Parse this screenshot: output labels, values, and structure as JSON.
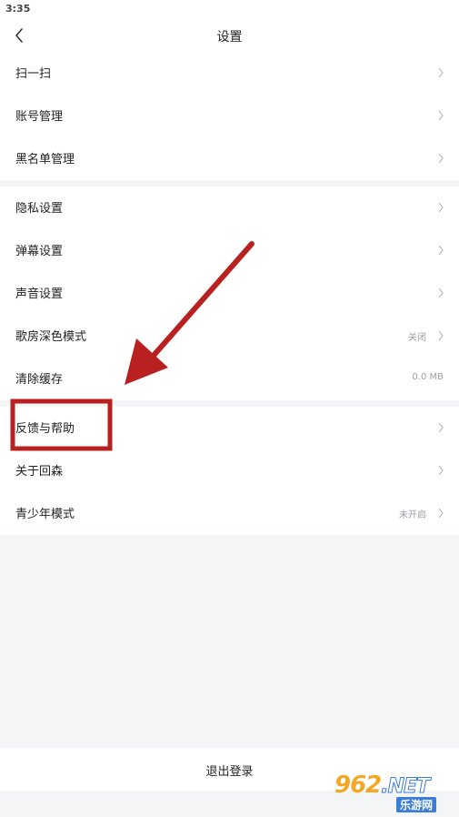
{
  "status_bar": {
    "time": "3:35"
  },
  "header": {
    "title": "设置"
  },
  "groups": [
    {
      "items": [
        {
          "label": "扫一扫"
        },
        {
          "label": "账号管理"
        },
        {
          "label": "黑名单管理"
        }
      ]
    },
    {
      "items": [
        {
          "label": "隐私设置"
        },
        {
          "label": "弹幕设置"
        },
        {
          "label": "声音设置"
        },
        {
          "label": "歌房深色模式",
          "value": "关闭"
        },
        {
          "label": "清除缓存",
          "value": "0.0 MB"
        }
      ]
    },
    {
      "items": [
        {
          "label": "反馈与帮助"
        },
        {
          "label": "关于回森"
        },
        {
          "label": "青少年模式",
          "value": "未开启"
        }
      ]
    }
  ],
  "logout": {
    "label": "退出登录"
  },
  "annotation": {
    "color": "#b8211f"
  },
  "watermark": {
    "main": "962",
    "suffix": ".NET",
    "sub": "乐游网"
  },
  "icons": {
    "back": "chevron-left-icon",
    "row": "chevron-right-icon"
  }
}
